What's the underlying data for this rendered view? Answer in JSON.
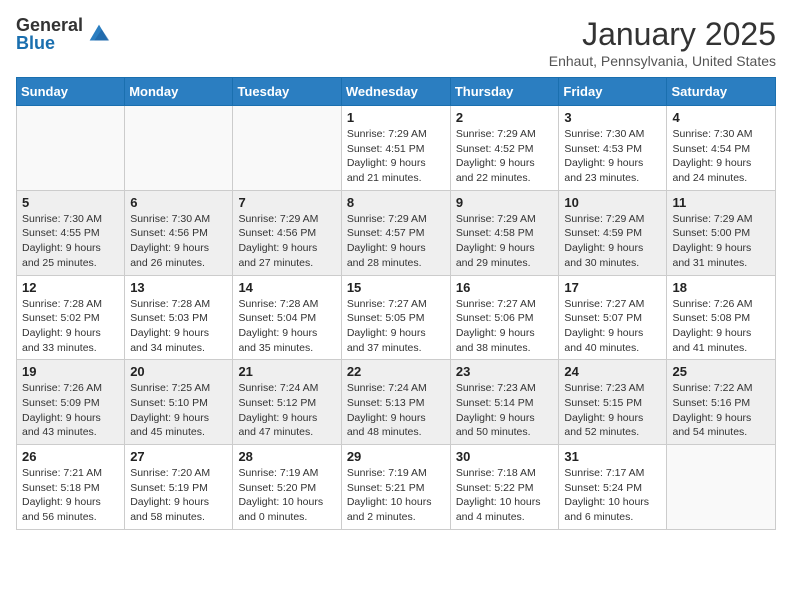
{
  "header": {
    "logo_general": "General",
    "logo_blue": "Blue",
    "month_title": "January 2025",
    "location": "Enhaut, Pennsylvania, United States"
  },
  "weekdays": [
    "Sunday",
    "Monday",
    "Tuesday",
    "Wednesday",
    "Thursday",
    "Friday",
    "Saturday"
  ],
  "weeks": [
    [
      {
        "day": "",
        "info": ""
      },
      {
        "day": "",
        "info": ""
      },
      {
        "day": "",
        "info": ""
      },
      {
        "day": "1",
        "info": "Sunrise: 7:29 AM\nSunset: 4:51 PM\nDaylight: 9 hours and 21 minutes."
      },
      {
        "day": "2",
        "info": "Sunrise: 7:29 AM\nSunset: 4:52 PM\nDaylight: 9 hours and 22 minutes."
      },
      {
        "day": "3",
        "info": "Sunrise: 7:30 AM\nSunset: 4:53 PM\nDaylight: 9 hours and 23 minutes."
      },
      {
        "day": "4",
        "info": "Sunrise: 7:30 AM\nSunset: 4:54 PM\nDaylight: 9 hours and 24 minutes."
      }
    ],
    [
      {
        "day": "5",
        "info": "Sunrise: 7:30 AM\nSunset: 4:55 PM\nDaylight: 9 hours and 25 minutes."
      },
      {
        "day": "6",
        "info": "Sunrise: 7:30 AM\nSunset: 4:56 PM\nDaylight: 9 hours and 26 minutes."
      },
      {
        "day": "7",
        "info": "Sunrise: 7:29 AM\nSunset: 4:56 PM\nDaylight: 9 hours and 27 minutes."
      },
      {
        "day": "8",
        "info": "Sunrise: 7:29 AM\nSunset: 4:57 PM\nDaylight: 9 hours and 28 minutes."
      },
      {
        "day": "9",
        "info": "Sunrise: 7:29 AM\nSunset: 4:58 PM\nDaylight: 9 hours and 29 minutes."
      },
      {
        "day": "10",
        "info": "Sunrise: 7:29 AM\nSunset: 4:59 PM\nDaylight: 9 hours and 30 minutes."
      },
      {
        "day": "11",
        "info": "Sunrise: 7:29 AM\nSunset: 5:00 PM\nDaylight: 9 hours and 31 minutes."
      }
    ],
    [
      {
        "day": "12",
        "info": "Sunrise: 7:28 AM\nSunset: 5:02 PM\nDaylight: 9 hours and 33 minutes."
      },
      {
        "day": "13",
        "info": "Sunrise: 7:28 AM\nSunset: 5:03 PM\nDaylight: 9 hours and 34 minutes."
      },
      {
        "day": "14",
        "info": "Sunrise: 7:28 AM\nSunset: 5:04 PM\nDaylight: 9 hours and 35 minutes."
      },
      {
        "day": "15",
        "info": "Sunrise: 7:27 AM\nSunset: 5:05 PM\nDaylight: 9 hours and 37 minutes."
      },
      {
        "day": "16",
        "info": "Sunrise: 7:27 AM\nSunset: 5:06 PM\nDaylight: 9 hours and 38 minutes."
      },
      {
        "day": "17",
        "info": "Sunrise: 7:27 AM\nSunset: 5:07 PM\nDaylight: 9 hours and 40 minutes."
      },
      {
        "day": "18",
        "info": "Sunrise: 7:26 AM\nSunset: 5:08 PM\nDaylight: 9 hours and 41 minutes."
      }
    ],
    [
      {
        "day": "19",
        "info": "Sunrise: 7:26 AM\nSunset: 5:09 PM\nDaylight: 9 hours and 43 minutes."
      },
      {
        "day": "20",
        "info": "Sunrise: 7:25 AM\nSunset: 5:10 PM\nDaylight: 9 hours and 45 minutes."
      },
      {
        "day": "21",
        "info": "Sunrise: 7:24 AM\nSunset: 5:12 PM\nDaylight: 9 hours and 47 minutes."
      },
      {
        "day": "22",
        "info": "Sunrise: 7:24 AM\nSunset: 5:13 PM\nDaylight: 9 hours and 48 minutes."
      },
      {
        "day": "23",
        "info": "Sunrise: 7:23 AM\nSunset: 5:14 PM\nDaylight: 9 hours and 50 minutes."
      },
      {
        "day": "24",
        "info": "Sunrise: 7:23 AM\nSunset: 5:15 PM\nDaylight: 9 hours and 52 minutes."
      },
      {
        "day": "25",
        "info": "Sunrise: 7:22 AM\nSunset: 5:16 PM\nDaylight: 9 hours and 54 minutes."
      }
    ],
    [
      {
        "day": "26",
        "info": "Sunrise: 7:21 AM\nSunset: 5:18 PM\nDaylight: 9 hours and 56 minutes."
      },
      {
        "day": "27",
        "info": "Sunrise: 7:20 AM\nSunset: 5:19 PM\nDaylight: 9 hours and 58 minutes."
      },
      {
        "day": "28",
        "info": "Sunrise: 7:19 AM\nSunset: 5:20 PM\nDaylight: 10 hours and 0 minutes."
      },
      {
        "day": "29",
        "info": "Sunrise: 7:19 AM\nSunset: 5:21 PM\nDaylight: 10 hours and 2 minutes."
      },
      {
        "day": "30",
        "info": "Sunrise: 7:18 AM\nSunset: 5:22 PM\nDaylight: 10 hours and 4 minutes."
      },
      {
        "day": "31",
        "info": "Sunrise: 7:17 AM\nSunset: 5:24 PM\nDaylight: 10 hours and 6 minutes."
      },
      {
        "day": "",
        "info": ""
      }
    ]
  ]
}
